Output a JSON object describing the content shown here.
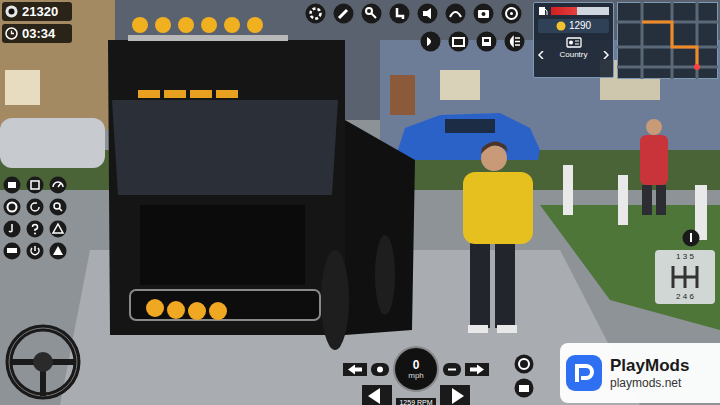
{
  "stats": {
    "money": "21320",
    "time": "03:34"
  },
  "panel": {
    "fuel_level": 0.45,
    "coins": "1290",
    "radio_station": "Country"
  },
  "gearbox": {
    "top": "1 3 5",
    "bottom": "2 4 6"
  },
  "dashboard": {
    "speed": "0",
    "unit": "mph",
    "rpm": "1259 RPM"
  },
  "watermark": {
    "brand": "PlayMods",
    "url": "playmods.net"
  }
}
